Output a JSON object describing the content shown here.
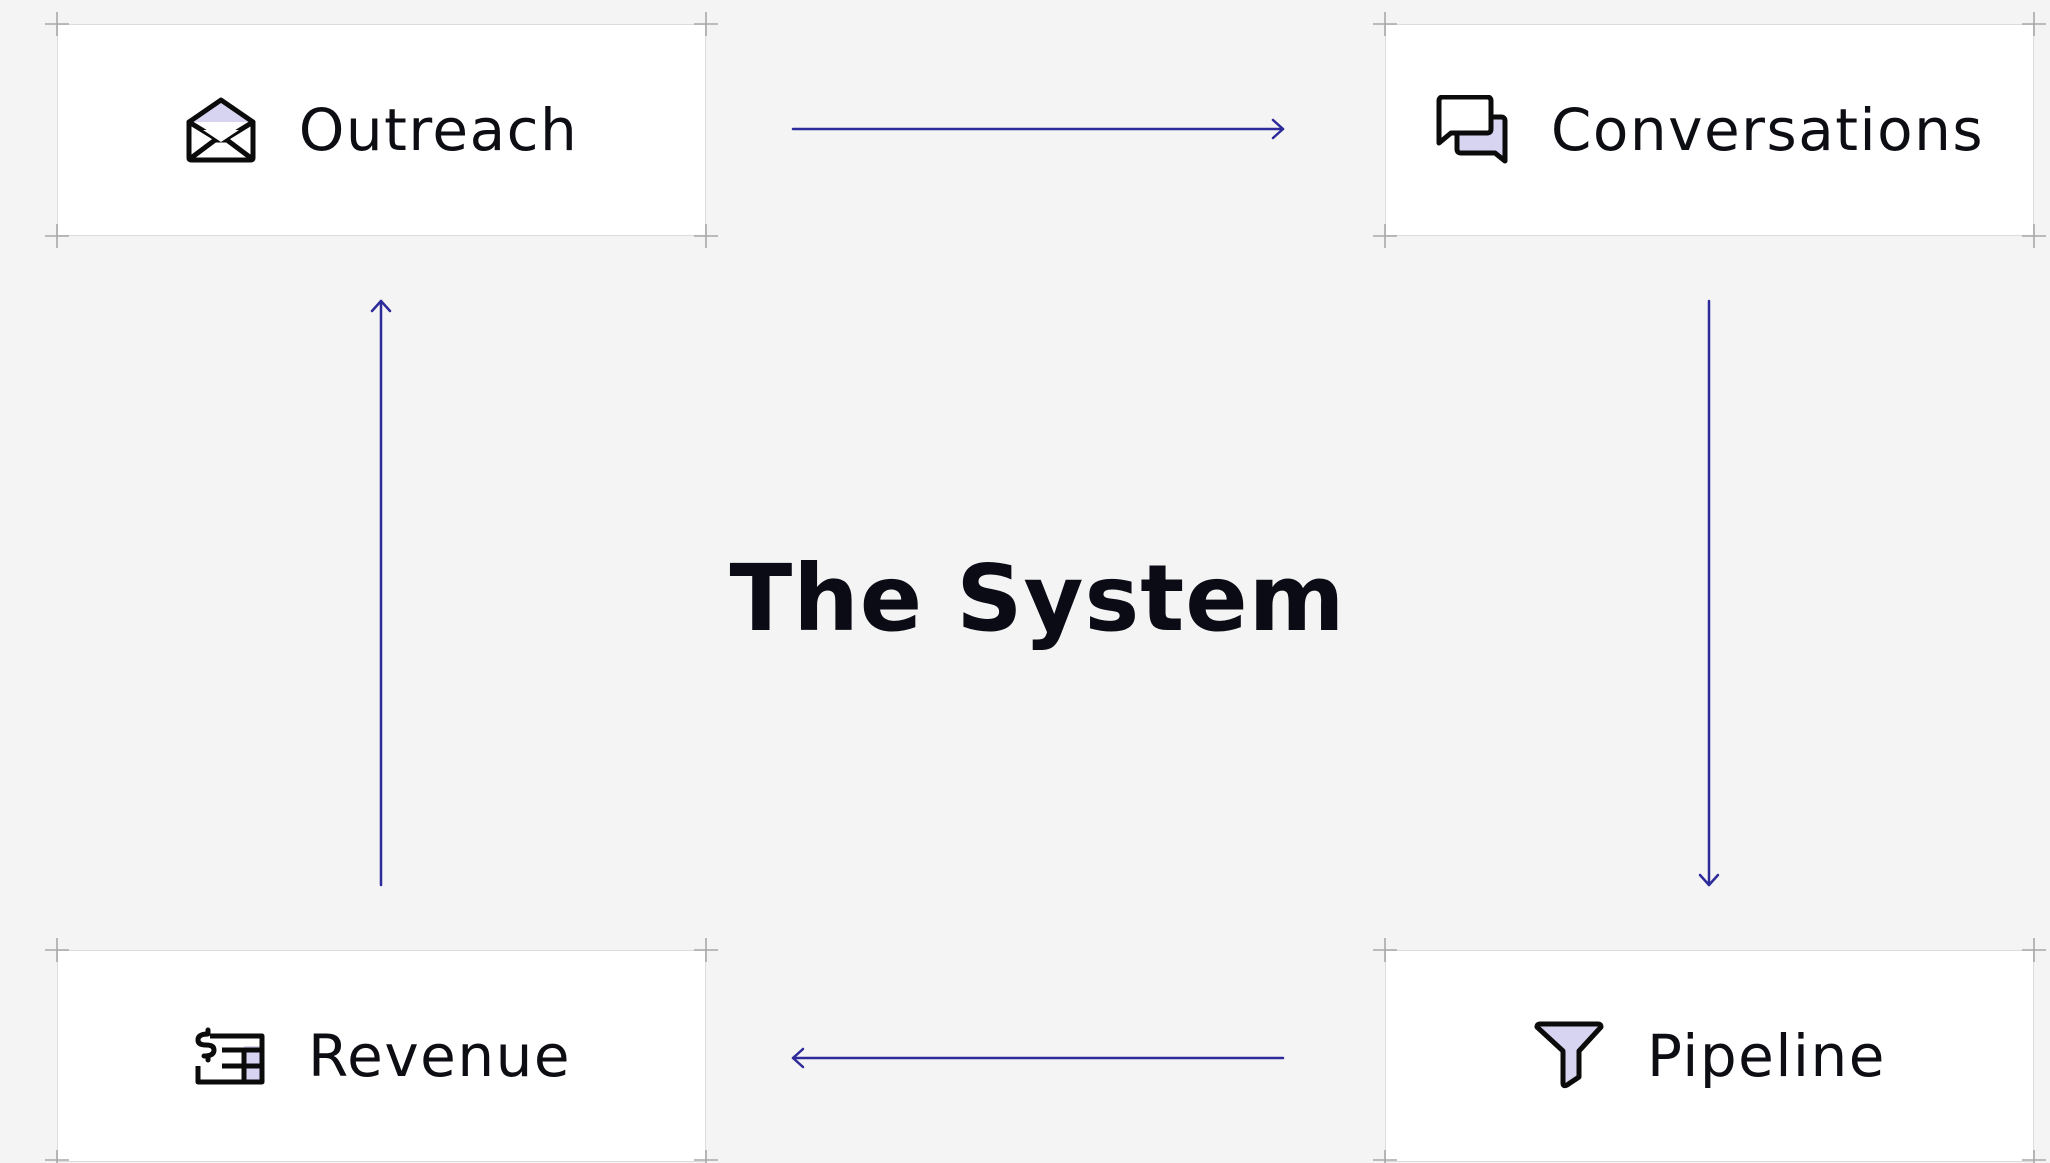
{
  "title": "The System",
  "nodes": {
    "outreach": {
      "label": "Outreach",
      "icon": "envelope-open-icon"
    },
    "conversations": {
      "label": "Conversations",
      "icon": "chat-bubbles-icon"
    },
    "pipeline": {
      "label": "Pipeline",
      "icon": "funnel-icon"
    },
    "revenue": {
      "label": "Revenue",
      "icon": "invoice-dollar-icon"
    }
  },
  "flow": [
    {
      "from": "Outreach",
      "to": "Conversations",
      "direction": "right"
    },
    {
      "from": "Conversations",
      "to": "Pipeline",
      "direction": "down"
    },
    {
      "from": "Pipeline",
      "to": "Revenue",
      "direction": "left"
    },
    {
      "from": "Revenue",
      "to": "Outreach",
      "direction": "up"
    }
  ],
  "colors": {
    "background": "#f4f4f4",
    "card": "#ffffff",
    "arrow": "#2d2a9a",
    "icon_fill": "#d6d4f0",
    "text": "#0d0d14"
  }
}
